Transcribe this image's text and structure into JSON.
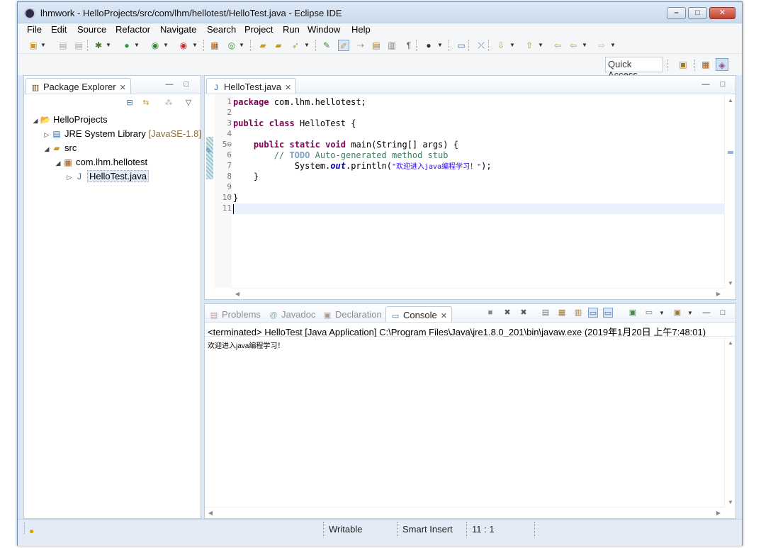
{
  "window": {
    "title": "lhmwork - HelloProjects/src/com/lhm/hellotest/HelloTest.java - Eclipse IDE",
    "controls": {
      "minimize": "–",
      "maximize": "□",
      "close": "✕"
    }
  },
  "menu": [
    "File",
    "Edit",
    "Source",
    "Refactor",
    "Navigate",
    "Search",
    "Project",
    "Run",
    "Window",
    "Help"
  ],
  "quick_access": {
    "placeholder": "Quick Access"
  },
  "package_explorer": {
    "tab_label": "Package Explorer",
    "tree": [
      {
        "label": "HelloProjects",
        "decoration": "",
        "icon": "project-icon"
      },
      {
        "label": "JRE System Library",
        "decoration": "[JavaSE-1.8]",
        "icon": "library-icon"
      },
      {
        "label": "src",
        "decoration": "",
        "icon": "source-folder-icon"
      },
      {
        "label": "com.lhm.hellotest",
        "decoration": "",
        "icon": "package-icon"
      },
      {
        "label": "HelloTest.java",
        "decoration": "",
        "icon": "java-file-icon",
        "selected": true
      }
    ]
  },
  "editor": {
    "tab_label": "HelloTest.java",
    "line_numbers": [
      "1",
      "2",
      "3",
      "4",
      "5⊖",
      "6",
      "7",
      "8",
      "9",
      "10",
      "11"
    ],
    "code": {
      "l1_kw": "package",
      "l1_rest": " com.lhm.hellotest;",
      "l3_kw1": "public",
      "l3_kw2": "class",
      "l3_rest": " HelloTest {",
      "l5_indent": "    ",
      "l5_kw1": "public",
      "l5_kw2": "static",
      "l5_kw3": "void",
      "l5_rest": " main(String[] args) {",
      "l6_indent": "        ",
      "l6_comment": "// ",
      "l6_todo": "TODO",
      "l6_comment2": " Auto-generated method stub",
      "l7_pre": "            System.",
      "l7_field": "out",
      "l7_mid": ".println(",
      "l7_str": "\"欢迎进入java编程学习！\"",
      "l7_end": ");",
      "l8": "    }",
      "l10": "}"
    }
  },
  "bottom_panel": {
    "tabs": [
      "Problems",
      "Javadoc",
      "Declaration",
      "Console"
    ],
    "active_tab": "Console",
    "console_status": "<terminated> HelloTest [Java Application] C:\\Program Files\\Java\\jre1.8.0_201\\bin\\javaw.exe (2019年1月20日 上午7:48:01)",
    "console_output": "欢迎进入java编程学习！"
  },
  "status_bar": {
    "writable": "Writable",
    "insert_mode": "Smart Insert",
    "position": "11 : 1"
  }
}
